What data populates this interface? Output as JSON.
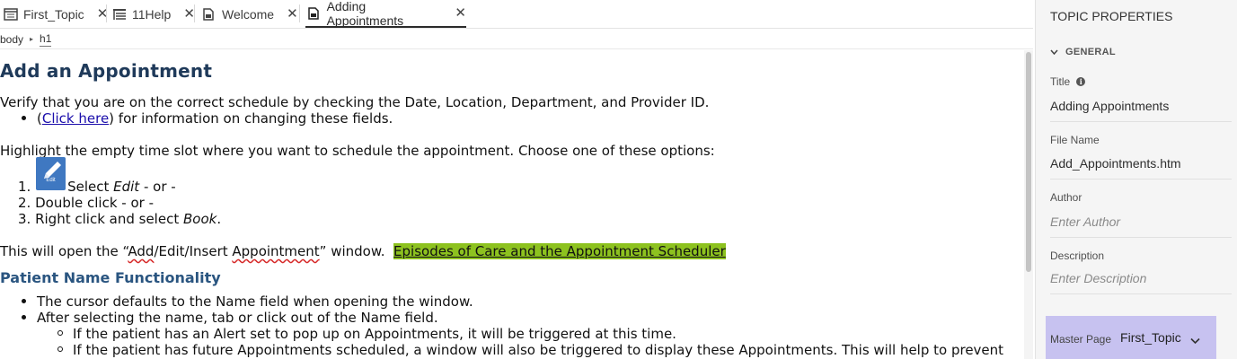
{
  "tabs": [
    {
      "label": "First_Topic",
      "icon": "master-page-icon",
      "close": "✕"
    },
    {
      "label": "11Help",
      "icon": "toc-icon",
      "close": "✕"
    },
    {
      "label": "Welcome",
      "icon": "topic-file-icon",
      "close": "✕"
    },
    {
      "label": "Adding Appointments",
      "icon": "topic-file-icon",
      "close": "✕",
      "active": true
    }
  ],
  "breadcrumb": {
    "items": [
      "body",
      "h1"
    ],
    "separator": "▸"
  },
  "content": {
    "heading": "Add an Appointment",
    "verify_text": "Verify that you are on the correct schedule by checking the Date, Location, Department, and Provider ID.",
    "bullet1_open": "(",
    "bullet1_link": "Click here",
    "bullet1_rest": ") for information on changing these fields.",
    "highlight_text": "Highlight the empty time slot where you want to schedule the appointment. Choose one of these options:",
    "edit_icon_label": "Edit",
    "steps": [
      {
        "num": "1.",
        "pre": "Select ",
        "em": "Edit",
        "post": " - or -"
      },
      {
        "num": "2.",
        "pre": "Double click - or -",
        "em": "",
        "post": ""
      },
      {
        "num": "3.",
        "pre": "Right click and select ",
        "em": "Book",
        "post": "."
      }
    ],
    "open_pre": "This will open the “",
    "open_squig1": "Add",
    "open_mid": "/Edit/Insert ",
    "open_squig2": "Appointment",
    "open_post": "” window.",
    "episodes_link": "Episodes of Care and the Appointment Scheduler",
    "subheading": "Patient Name Functionality",
    "bullets": [
      "The cursor defaults to the Name field when opening the window.",
      "After selecting the name, tab or click out of the Name field."
    ],
    "sub_bullets": [
      "If the patient has an Alert set to pop up on Appointments, it will be triggered at this time.",
      "If the patient has future Appointments scheduled, a window will also be triggered to display these Appointments. This will help to prevent"
    ]
  },
  "panel": {
    "title": "TOPIC PROPERTIES",
    "section": "GENERAL",
    "title_label": "Title",
    "title_value": "Adding Appointments",
    "filename_label": "File Name",
    "filename_value": "Add_Appointments.htm",
    "author_label": "Author",
    "author_placeholder": "Enter Author",
    "description_label": "Description",
    "description_placeholder": "Enter Description",
    "master_label": "Master Page",
    "master_value": "First_Topic"
  },
  "colors": {
    "heading": "#1f3a5a",
    "subheading": "#2a5580",
    "link": "#1a0dab",
    "highlight": "#8dc21f",
    "master_bg": "#c7c2f0",
    "edit_icon_bg": "#3f78c1"
  }
}
